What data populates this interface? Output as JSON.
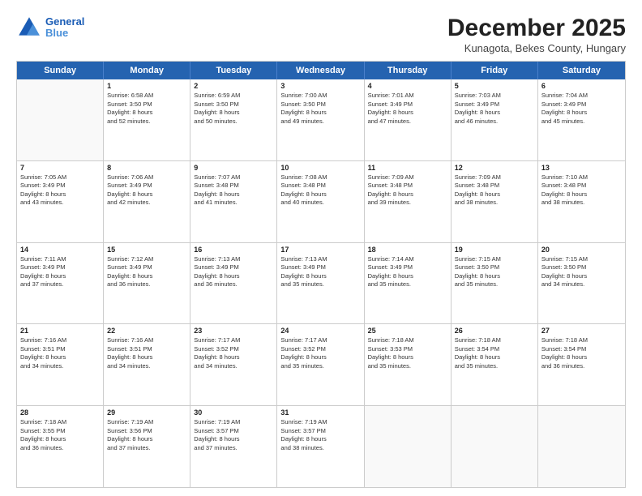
{
  "header": {
    "logo_line1": "General",
    "logo_line2": "Blue",
    "title": "December 2025",
    "subtitle": "Kunagota, Bekes County, Hungary"
  },
  "calendar": {
    "days": [
      "Sunday",
      "Monday",
      "Tuesday",
      "Wednesday",
      "Thursday",
      "Friday",
      "Saturday"
    ],
    "rows": [
      [
        {
          "day": "",
          "empty": true
        },
        {
          "day": "1",
          "sunrise": "6:58 AM",
          "sunset": "3:50 PM",
          "daylight": "8 hours and 52 minutes."
        },
        {
          "day": "2",
          "sunrise": "6:59 AM",
          "sunset": "3:50 PM",
          "daylight": "8 hours and 50 minutes."
        },
        {
          "day": "3",
          "sunrise": "7:00 AM",
          "sunset": "3:50 PM",
          "daylight": "8 hours and 49 minutes."
        },
        {
          "day": "4",
          "sunrise": "7:01 AM",
          "sunset": "3:49 PM",
          "daylight": "8 hours and 47 minutes."
        },
        {
          "day": "5",
          "sunrise": "7:03 AM",
          "sunset": "3:49 PM",
          "daylight": "8 hours and 46 minutes."
        },
        {
          "day": "6",
          "sunrise": "7:04 AM",
          "sunset": "3:49 PM",
          "daylight": "8 hours and 45 minutes."
        }
      ],
      [
        {
          "day": "7",
          "sunrise": "7:05 AM",
          "sunset": "3:49 PM",
          "daylight": "8 hours and 43 minutes."
        },
        {
          "day": "8",
          "sunrise": "7:06 AM",
          "sunset": "3:49 PM",
          "daylight": "8 hours and 42 minutes."
        },
        {
          "day": "9",
          "sunrise": "7:07 AM",
          "sunset": "3:48 PM",
          "daylight": "8 hours and 41 minutes."
        },
        {
          "day": "10",
          "sunrise": "7:08 AM",
          "sunset": "3:48 PM",
          "daylight": "8 hours and 40 minutes."
        },
        {
          "day": "11",
          "sunrise": "7:09 AM",
          "sunset": "3:48 PM",
          "daylight": "8 hours and 39 minutes."
        },
        {
          "day": "12",
          "sunrise": "7:09 AM",
          "sunset": "3:48 PM",
          "daylight": "8 hours and 38 minutes."
        },
        {
          "day": "13",
          "sunrise": "7:10 AM",
          "sunset": "3:48 PM",
          "daylight": "8 hours and 38 minutes."
        }
      ],
      [
        {
          "day": "14",
          "sunrise": "7:11 AM",
          "sunset": "3:49 PM",
          "daylight": "8 hours and 37 minutes."
        },
        {
          "day": "15",
          "sunrise": "7:12 AM",
          "sunset": "3:49 PM",
          "daylight": "8 hours and 36 minutes."
        },
        {
          "day": "16",
          "sunrise": "7:13 AM",
          "sunset": "3:49 PM",
          "daylight": "8 hours and 36 minutes."
        },
        {
          "day": "17",
          "sunrise": "7:13 AM",
          "sunset": "3:49 PM",
          "daylight": "8 hours and 35 minutes."
        },
        {
          "day": "18",
          "sunrise": "7:14 AM",
          "sunset": "3:49 PM",
          "daylight": "8 hours and 35 minutes."
        },
        {
          "day": "19",
          "sunrise": "7:15 AM",
          "sunset": "3:50 PM",
          "daylight": "8 hours and 35 minutes."
        },
        {
          "day": "20",
          "sunrise": "7:15 AM",
          "sunset": "3:50 PM",
          "daylight": "8 hours and 34 minutes."
        }
      ],
      [
        {
          "day": "21",
          "sunrise": "7:16 AM",
          "sunset": "3:51 PM",
          "daylight": "8 hours and 34 minutes."
        },
        {
          "day": "22",
          "sunrise": "7:16 AM",
          "sunset": "3:51 PM",
          "daylight": "8 hours and 34 minutes."
        },
        {
          "day": "23",
          "sunrise": "7:17 AM",
          "sunset": "3:52 PM",
          "daylight": "8 hours and 34 minutes."
        },
        {
          "day": "24",
          "sunrise": "7:17 AM",
          "sunset": "3:52 PM",
          "daylight": "8 hours and 35 minutes."
        },
        {
          "day": "25",
          "sunrise": "7:18 AM",
          "sunset": "3:53 PM",
          "daylight": "8 hours and 35 minutes."
        },
        {
          "day": "26",
          "sunrise": "7:18 AM",
          "sunset": "3:54 PM",
          "daylight": "8 hours and 35 minutes."
        },
        {
          "day": "27",
          "sunrise": "7:18 AM",
          "sunset": "3:54 PM",
          "daylight": "8 hours and 36 minutes."
        }
      ],
      [
        {
          "day": "28",
          "sunrise": "7:18 AM",
          "sunset": "3:55 PM",
          "daylight": "8 hours and 36 minutes."
        },
        {
          "day": "29",
          "sunrise": "7:19 AM",
          "sunset": "3:56 PM",
          "daylight": "8 hours and 37 minutes."
        },
        {
          "day": "30",
          "sunrise": "7:19 AM",
          "sunset": "3:57 PM",
          "daylight": "8 hours and 37 minutes."
        },
        {
          "day": "31",
          "sunrise": "7:19 AM",
          "sunset": "3:57 PM",
          "daylight": "8 hours and 38 minutes."
        },
        {
          "day": "",
          "empty": true
        },
        {
          "day": "",
          "empty": true
        },
        {
          "day": "",
          "empty": true
        }
      ]
    ]
  }
}
